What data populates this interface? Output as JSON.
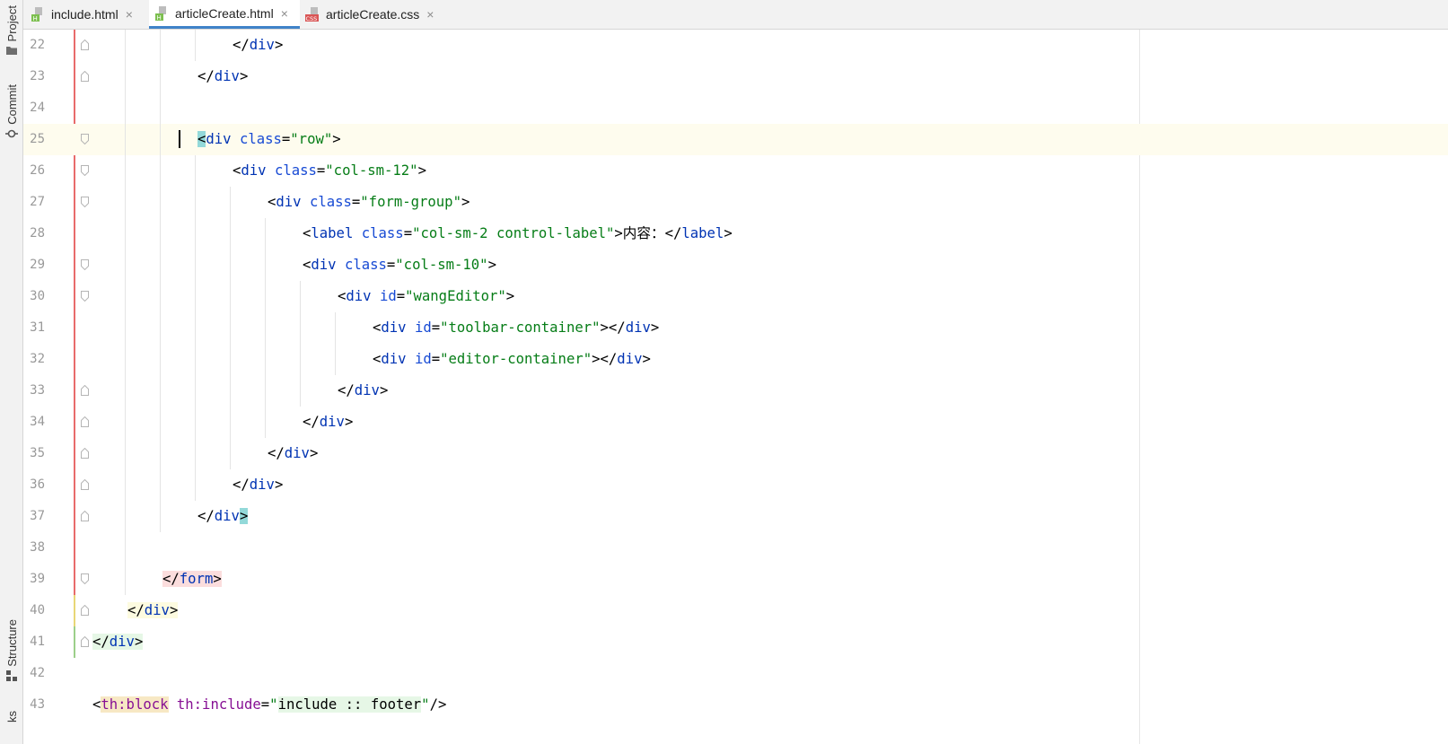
{
  "tool_strip": {
    "items": [
      {
        "label": "Project",
        "icon": "folder-icon"
      },
      {
        "label": "Commit",
        "icon": "commit-icon"
      },
      {
        "label": "Structure",
        "icon": "structure-icon"
      },
      {
        "label": "ks",
        "icon": ""
      }
    ]
  },
  "tabs": [
    {
      "label": "include.html",
      "icon": "html-file-icon",
      "icon_text": "H",
      "close": "×",
      "active": false
    },
    {
      "label": "articleCreate.html",
      "icon": "html-file-icon",
      "icon_text": "H",
      "close": "×",
      "active": true
    },
    {
      "label": "articleCreate.css",
      "icon": "css-file-icon",
      "icon_text": "CSS",
      "close": "×",
      "active": false
    }
  ],
  "colors": {
    "tag": "#0033b3",
    "attr_name": "#174ad4",
    "attr_value": "#067d17",
    "namespace": "#871094",
    "line_number": "#999999",
    "active_tab_underline": "#4083c9",
    "current_line": "#fefcee"
  },
  "editor": {
    "lines": [
      {
        "num": "22",
        "parts": [
          {
            "t": "</",
            "c": "tg"
          },
          {
            "t": "div",
            "c": "tn"
          },
          {
            "t": ">",
            "c": "tg"
          }
        ]
      },
      {
        "num": "23",
        "parts": [
          {
            "t": "</",
            "c": "tg"
          },
          {
            "t": "div",
            "c": "tn"
          },
          {
            "t": ">",
            "c": "tg"
          }
        ]
      },
      {
        "num": "24",
        "parts": []
      },
      {
        "num": "25",
        "parts": [
          {
            "t": "<",
            "c": "tg hl-match"
          },
          {
            "t": "div",
            "c": "tn"
          },
          {
            "t": " class",
            "c": "an"
          },
          {
            "t": "=",
            "c": "tg"
          },
          {
            "t": "\"row\"",
            "c": "av"
          },
          {
            "t": ">",
            "c": "tg"
          }
        ]
      },
      {
        "num": "26",
        "parts": [
          {
            "t": "<",
            "c": "tg"
          },
          {
            "t": "div",
            "c": "tn"
          },
          {
            "t": " class",
            "c": "an"
          },
          {
            "t": "=",
            "c": "tg"
          },
          {
            "t": "\"col-sm-12\"",
            "c": "av"
          },
          {
            "t": ">",
            "c": "tg"
          }
        ]
      },
      {
        "num": "27",
        "parts": [
          {
            "t": "<",
            "c": "tg"
          },
          {
            "t": "div",
            "c": "tn"
          },
          {
            "t": " class",
            "c": "an"
          },
          {
            "t": "=",
            "c": "tg"
          },
          {
            "t": "\"form-group\"",
            "c": "av"
          },
          {
            "t": ">",
            "c": "tg"
          }
        ]
      },
      {
        "num": "28",
        "parts": [
          {
            "t": "<",
            "c": "tg"
          },
          {
            "t": "label",
            "c": "tn"
          },
          {
            "t": " class",
            "c": "an"
          },
          {
            "t": "=",
            "c": "tg"
          },
          {
            "t": "\"col-sm-2 control-label\"",
            "c": "av"
          },
          {
            "t": ">",
            "c": "tg"
          },
          {
            "t": "内容：",
            "c": "tg"
          },
          {
            "t": "</",
            "c": "tg"
          },
          {
            "t": "label",
            "c": "tn"
          },
          {
            "t": ">",
            "c": "tg"
          }
        ]
      },
      {
        "num": "29",
        "parts": [
          {
            "t": "<",
            "c": "tg"
          },
          {
            "t": "div",
            "c": "tn"
          },
          {
            "t": " class",
            "c": "an"
          },
          {
            "t": "=",
            "c": "tg"
          },
          {
            "t": "\"col-sm-10\"",
            "c": "av"
          },
          {
            "t": ">",
            "c": "tg"
          }
        ]
      },
      {
        "num": "30",
        "parts": [
          {
            "t": "<",
            "c": "tg"
          },
          {
            "t": "div",
            "c": "tn"
          },
          {
            "t": " id",
            "c": "an"
          },
          {
            "t": "=",
            "c": "tg"
          },
          {
            "t": "\"wangEditor\"",
            "c": "av"
          },
          {
            "t": ">",
            "c": "tg"
          }
        ]
      },
      {
        "num": "31",
        "parts": [
          {
            "t": "<",
            "c": "tg"
          },
          {
            "t": "div",
            "c": "tn"
          },
          {
            "t": " id",
            "c": "an"
          },
          {
            "t": "=",
            "c": "tg"
          },
          {
            "t": "\"toolbar-container\"",
            "c": "av"
          },
          {
            "t": "></",
            "c": "tg"
          },
          {
            "t": "div",
            "c": "tn"
          },
          {
            "t": ">",
            "c": "tg"
          }
        ]
      },
      {
        "num": "32",
        "parts": [
          {
            "t": "<",
            "c": "tg"
          },
          {
            "t": "div",
            "c": "tn"
          },
          {
            "t": " id",
            "c": "an"
          },
          {
            "t": "=",
            "c": "tg"
          },
          {
            "t": "\"editor-container\"",
            "c": "av"
          },
          {
            "t": "></",
            "c": "tg"
          },
          {
            "t": "div",
            "c": "tn"
          },
          {
            "t": ">",
            "c": "tg"
          }
        ]
      },
      {
        "num": "33",
        "parts": [
          {
            "t": "</",
            "c": "tg"
          },
          {
            "t": "div",
            "c": "tn"
          },
          {
            "t": ">",
            "c": "tg"
          }
        ]
      },
      {
        "num": "34",
        "parts": [
          {
            "t": "</",
            "c": "tg"
          },
          {
            "t": "div",
            "c": "tn"
          },
          {
            "t": ">",
            "c": "tg"
          }
        ]
      },
      {
        "num": "35",
        "parts": [
          {
            "t": "</",
            "c": "tg"
          },
          {
            "t": "div",
            "c": "tn"
          },
          {
            "t": ">",
            "c": "tg"
          }
        ]
      },
      {
        "num": "36",
        "parts": [
          {
            "t": "</",
            "c": "tg"
          },
          {
            "t": "div",
            "c": "tn"
          },
          {
            "t": ">",
            "c": "tg"
          }
        ]
      },
      {
        "num": "37",
        "parts": [
          {
            "t": "</",
            "c": "tg"
          },
          {
            "t": "div",
            "c": "tn"
          },
          {
            "t": ">",
            "c": "tg hl-match"
          }
        ]
      },
      {
        "num": "38",
        "parts": []
      },
      {
        "num": "39",
        "parts": [
          {
            "t": "</",
            "c": "tg hl-red"
          },
          {
            "t": "form",
            "c": "tn hl-red"
          },
          {
            "t": ">",
            "c": "tg hl-red"
          }
        ]
      },
      {
        "num": "40",
        "parts": [
          {
            "t": "</",
            "c": "tg hl-yellow"
          },
          {
            "t": "div",
            "c": "tn hl-yellow"
          },
          {
            "t": ">",
            "c": "tg hl-yellow"
          }
        ]
      },
      {
        "num": "41",
        "parts": [
          {
            "t": "</",
            "c": "tg hl-green"
          },
          {
            "t": "div",
            "c": "tn hl-green"
          },
          {
            "t": ">",
            "c": "tg hl-green"
          }
        ]
      },
      {
        "num": "42",
        "parts": []
      },
      {
        "num": "43",
        "parts": [
          {
            "t": "<",
            "c": "tg"
          },
          {
            "t": "th:block",
            "c": "ns hl-orange"
          },
          {
            "t": " th:include",
            "c": "ns"
          },
          {
            "t": "=",
            "c": "tg"
          },
          {
            "t": "\"",
            "c": "av"
          },
          {
            "t": "include :: footer",
            "c": "tg hl-green"
          },
          {
            "t": "\"",
            "c": "av"
          },
          {
            "t": "/>",
            "c": "tg"
          }
        ]
      }
    ]
  }
}
